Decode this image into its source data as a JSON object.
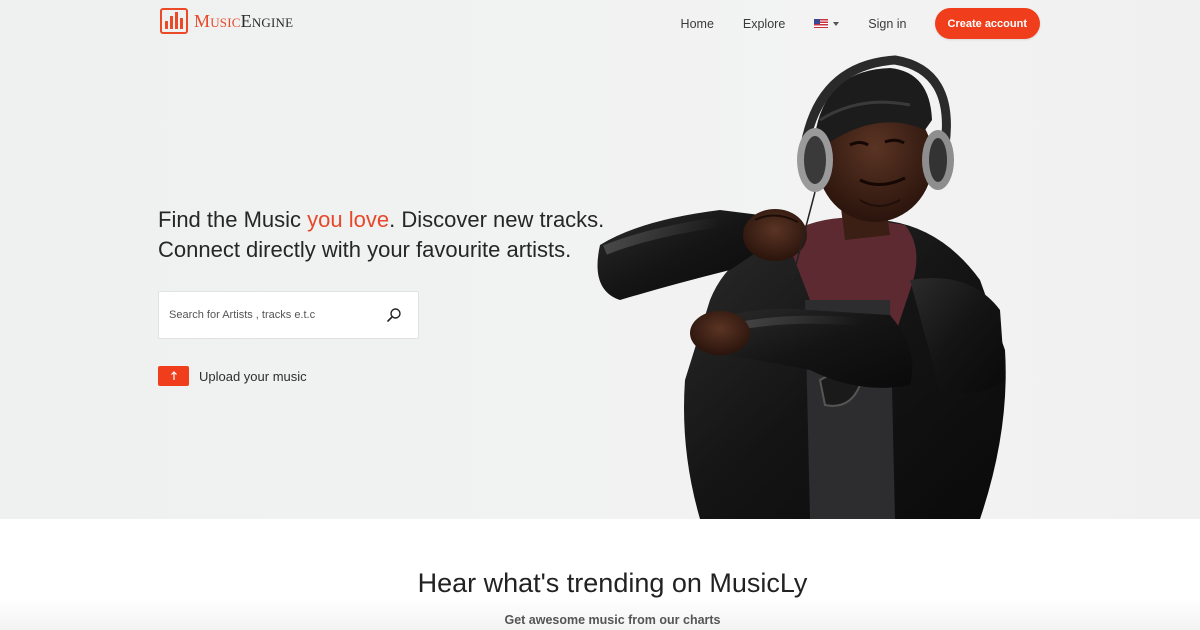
{
  "brand": {
    "name_part1": "Music",
    "name_part2": "Engine",
    "accent_color": "#f03e1c"
  },
  "nav": {
    "home": "Home",
    "explore": "Explore",
    "language_icon": "us-flag-icon",
    "sign_in": "Sign in",
    "create_account": "Create account"
  },
  "hero": {
    "headline_part1": "Find the Music ",
    "headline_accent": "you love",
    "headline_part2": ". Discover new tracks.",
    "headline_line2": "Connect directly with your favourite artists.",
    "search_placeholder": "Search for Artists , tracks e.t.c",
    "search_icon": "search-icon",
    "upload_label": "Upload your music",
    "upload_icon": "upload-arrow-icon"
  },
  "trending": {
    "title": "Hear what's trending on MusicLy",
    "subtitle": "Get awesome music from our charts"
  }
}
